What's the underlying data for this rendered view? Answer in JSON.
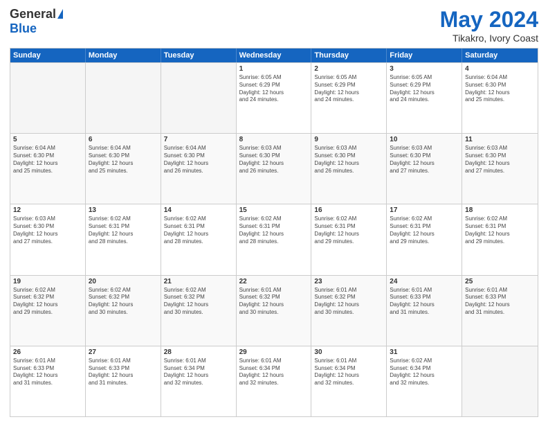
{
  "header": {
    "logo_general": "General",
    "logo_blue": "Blue",
    "month": "May 2024",
    "location": "Tikakro, Ivory Coast"
  },
  "days_header": [
    "Sunday",
    "Monday",
    "Tuesday",
    "Wednesday",
    "Thursday",
    "Friday",
    "Saturday"
  ],
  "rows": [
    [
      {
        "day": "",
        "text": ""
      },
      {
        "day": "",
        "text": ""
      },
      {
        "day": "",
        "text": ""
      },
      {
        "day": "1",
        "text": "Sunrise: 6:05 AM\nSunset: 6:29 PM\nDaylight: 12 hours\nand 24 minutes."
      },
      {
        "day": "2",
        "text": "Sunrise: 6:05 AM\nSunset: 6:29 PM\nDaylight: 12 hours\nand 24 minutes."
      },
      {
        "day": "3",
        "text": "Sunrise: 6:05 AM\nSunset: 6:29 PM\nDaylight: 12 hours\nand 24 minutes."
      },
      {
        "day": "4",
        "text": "Sunrise: 6:04 AM\nSunset: 6:30 PM\nDaylight: 12 hours\nand 25 minutes."
      }
    ],
    [
      {
        "day": "5",
        "text": "Sunrise: 6:04 AM\nSunset: 6:30 PM\nDaylight: 12 hours\nand 25 minutes."
      },
      {
        "day": "6",
        "text": "Sunrise: 6:04 AM\nSunset: 6:30 PM\nDaylight: 12 hours\nand 25 minutes."
      },
      {
        "day": "7",
        "text": "Sunrise: 6:04 AM\nSunset: 6:30 PM\nDaylight: 12 hours\nand 26 minutes."
      },
      {
        "day": "8",
        "text": "Sunrise: 6:03 AM\nSunset: 6:30 PM\nDaylight: 12 hours\nand 26 minutes."
      },
      {
        "day": "9",
        "text": "Sunrise: 6:03 AM\nSunset: 6:30 PM\nDaylight: 12 hours\nand 26 minutes."
      },
      {
        "day": "10",
        "text": "Sunrise: 6:03 AM\nSunset: 6:30 PM\nDaylight: 12 hours\nand 27 minutes."
      },
      {
        "day": "11",
        "text": "Sunrise: 6:03 AM\nSunset: 6:30 PM\nDaylight: 12 hours\nand 27 minutes."
      }
    ],
    [
      {
        "day": "12",
        "text": "Sunrise: 6:03 AM\nSunset: 6:30 PM\nDaylight: 12 hours\nand 27 minutes."
      },
      {
        "day": "13",
        "text": "Sunrise: 6:02 AM\nSunset: 6:31 PM\nDaylight: 12 hours\nand 28 minutes."
      },
      {
        "day": "14",
        "text": "Sunrise: 6:02 AM\nSunset: 6:31 PM\nDaylight: 12 hours\nand 28 minutes."
      },
      {
        "day": "15",
        "text": "Sunrise: 6:02 AM\nSunset: 6:31 PM\nDaylight: 12 hours\nand 28 minutes."
      },
      {
        "day": "16",
        "text": "Sunrise: 6:02 AM\nSunset: 6:31 PM\nDaylight: 12 hours\nand 29 minutes."
      },
      {
        "day": "17",
        "text": "Sunrise: 6:02 AM\nSunset: 6:31 PM\nDaylight: 12 hours\nand 29 minutes."
      },
      {
        "day": "18",
        "text": "Sunrise: 6:02 AM\nSunset: 6:31 PM\nDaylight: 12 hours\nand 29 minutes."
      }
    ],
    [
      {
        "day": "19",
        "text": "Sunrise: 6:02 AM\nSunset: 6:32 PM\nDaylight: 12 hours\nand 29 minutes."
      },
      {
        "day": "20",
        "text": "Sunrise: 6:02 AM\nSunset: 6:32 PM\nDaylight: 12 hours\nand 30 minutes."
      },
      {
        "day": "21",
        "text": "Sunrise: 6:02 AM\nSunset: 6:32 PM\nDaylight: 12 hours\nand 30 minutes."
      },
      {
        "day": "22",
        "text": "Sunrise: 6:01 AM\nSunset: 6:32 PM\nDaylight: 12 hours\nand 30 minutes."
      },
      {
        "day": "23",
        "text": "Sunrise: 6:01 AM\nSunset: 6:32 PM\nDaylight: 12 hours\nand 30 minutes."
      },
      {
        "day": "24",
        "text": "Sunrise: 6:01 AM\nSunset: 6:33 PM\nDaylight: 12 hours\nand 31 minutes."
      },
      {
        "day": "25",
        "text": "Sunrise: 6:01 AM\nSunset: 6:33 PM\nDaylight: 12 hours\nand 31 minutes."
      }
    ],
    [
      {
        "day": "26",
        "text": "Sunrise: 6:01 AM\nSunset: 6:33 PM\nDaylight: 12 hours\nand 31 minutes."
      },
      {
        "day": "27",
        "text": "Sunrise: 6:01 AM\nSunset: 6:33 PM\nDaylight: 12 hours\nand 31 minutes."
      },
      {
        "day": "28",
        "text": "Sunrise: 6:01 AM\nSunset: 6:34 PM\nDaylight: 12 hours\nand 32 minutes."
      },
      {
        "day": "29",
        "text": "Sunrise: 6:01 AM\nSunset: 6:34 PM\nDaylight: 12 hours\nand 32 minutes."
      },
      {
        "day": "30",
        "text": "Sunrise: 6:01 AM\nSunset: 6:34 PM\nDaylight: 12 hours\nand 32 minutes."
      },
      {
        "day": "31",
        "text": "Sunrise: 6:02 AM\nSunset: 6:34 PM\nDaylight: 12 hours\nand 32 minutes."
      },
      {
        "day": "",
        "text": ""
      }
    ]
  ]
}
